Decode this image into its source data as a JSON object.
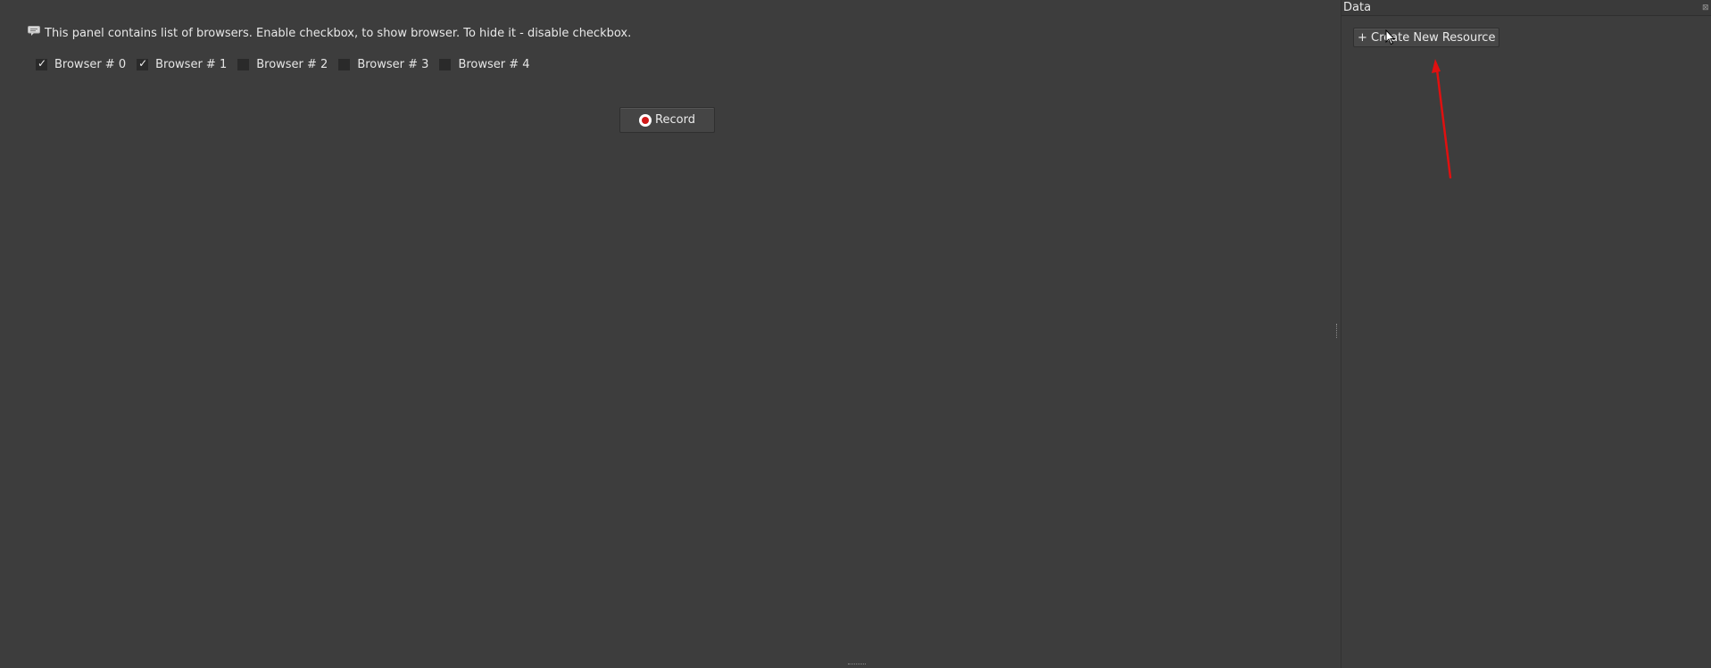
{
  "main": {
    "info_text": "This panel contains list of browsers. Enable checkbox, to show browser. To hide it - disable checkbox.",
    "browsers": [
      {
        "label": "Browser # 0",
        "checked": true
      },
      {
        "label": "Browser # 1",
        "checked": true
      },
      {
        "label": "Browser # 2",
        "checked": false
      },
      {
        "label": "Browser # 3",
        "checked": false
      },
      {
        "label": "Browser # 4",
        "checked": false
      }
    ],
    "record_label": "Record"
  },
  "data_panel": {
    "title": "Data",
    "create_button_label": "+ Create New Resource"
  },
  "icons": {
    "info": "comment-icon",
    "record": "record-icon",
    "close": "close-icon",
    "cursor": "mouse-cursor-icon",
    "annotation": "red-arrow-annotation"
  },
  "colors": {
    "background": "#3d3d3d",
    "record_red": "#d01818",
    "annotation_red": "#e01010"
  }
}
